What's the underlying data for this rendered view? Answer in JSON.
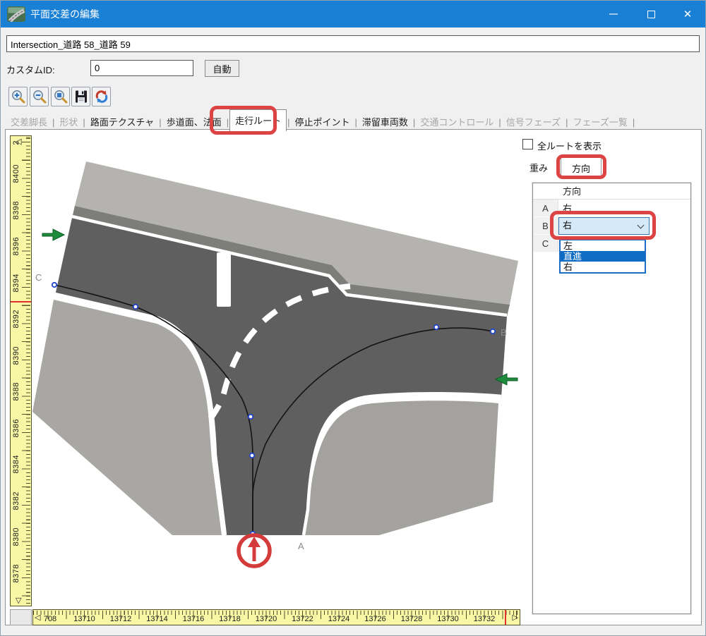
{
  "window": {
    "title": "平面交差の編集",
    "controls": {
      "close_glyph": "✕"
    }
  },
  "header": {
    "name_value": "Intersection_道路 58_道路 59",
    "custom_id_label": "カスタムID:",
    "custom_id_value": "0",
    "auto_button": "自動"
  },
  "toolbar": {
    "buttons": [
      {
        "name": "zoom-in-button",
        "icon": "magnifier-plus-icon"
      },
      {
        "name": "zoom-out-button",
        "icon": "magnifier-minus-icon"
      },
      {
        "name": "zoom-region-button",
        "icon": "magnifier-region-icon"
      },
      {
        "name": "save-button",
        "icon": "floppy-disk-icon"
      },
      {
        "name": "refresh-button",
        "icon": "refresh-arrows-icon"
      }
    ]
  },
  "tabs": [
    {
      "label": "交差脚長",
      "state": "disabled"
    },
    {
      "label": "形状",
      "state": "disabled"
    },
    {
      "label": "路面テクスチャ",
      "state": "normal"
    },
    {
      "label": "歩道面、法面",
      "state": "normal"
    },
    {
      "label": "走行ルート",
      "state": "active",
      "highlighted": true
    },
    {
      "label": "停止ポイント",
      "state": "normal"
    },
    {
      "label": "滞留車両数",
      "state": "normal"
    },
    {
      "label": "交通コントロール",
      "state": "disabled"
    },
    {
      "label": "信号フェーズ",
      "state": "disabled"
    },
    {
      "label": "フェーズ一覧",
      "state": "disabled"
    }
  ],
  "rulers": {
    "vertical": {
      "labels": [
        "2",
        "8400",
        "8398",
        "8396",
        "8394",
        "8392",
        "8390",
        "8388",
        "8386",
        "8384",
        "8382",
        "8380",
        "8378"
      ],
      "up_arrow": "◁",
      "down_arrow": "▽"
    },
    "horizontal": {
      "labels": [
        "708",
        "13710",
        "13712",
        "13714",
        "13716",
        "13718",
        "13720",
        "13722",
        "13724",
        "13726",
        "13728",
        "13730",
        "13732"
      ],
      "left_arrow": "◁",
      "right_arrow": "▷"
    }
  },
  "canvas": {
    "labels": {
      "a": "A",
      "b": "B",
      "c": "C"
    }
  },
  "panel": {
    "show_all_routes_label": "全ルートを表示",
    "show_all_routes_checked": false,
    "subtabs": [
      {
        "label": "重み",
        "active": false
      },
      {
        "label": "方向",
        "active": true,
        "highlighted": true
      }
    ],
    "table": {
      "column_header": "方向",
      "rows": [
        {
          "key": "A",
          "value": "右",
          "editing": false
        },
        {
          "key": "B",
          "value": "右",
          "editing": true
        },
        {
          "key": "C",
          "value": "",
          "editing": false
        }
      ]
    },
    "dropdown": {
      "selected": "右",
      "options": [
        "左",
        "直進",
        "右"
      ],
      "highlighted": "直進"
    }
  },
  "colors": {
    "titlebar": "#1a80d6",
    "accent": "#dc4343",
    "sel_blue": "#0f6cc5",
    "combo_fill": "#d6e9f8",
    "ruler_yellow": "#f7f7a6",
    "asphalt": "#5f5f5f",
    "sidewalk": "#b4b3b0",
    "arrow_green": "#1e8c3c",
    "marker_red": "#d43c3c",
    "node_blue": "#2343c8",
    "route": "#141414"
  }
}
